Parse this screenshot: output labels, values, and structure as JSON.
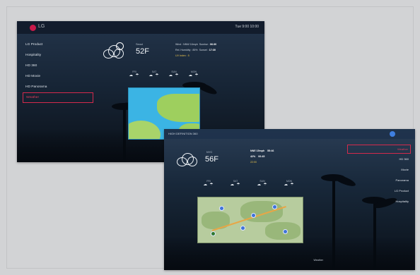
{
  "screen1": {
    "brand": "LG",
    "clock": "Tue 9:00 10:00",
    "menu": [
      "LG Product",
      "Hospitality",
      "HD 360",
      "HD Movie",
      "HD Panorama",
      "Weather"
    ],
    "weather": {
      "city": "Seoul",
      "temp": "52F",
      "wind": "Wind : NNW 16mph",
      "sunrise_label": "Sunrise :",
      "sunrise": "06:30",
      "humidity": "Rel. Humidity : 85%",
      "sunset_label": "Sunset :",
      "sunset": "17:30",
      "uv": "UV Index : 5"
    },
    "forecast": [
      {
        "day": "FRI",
        "icons": "☁ ☂"
      },
      {
        "day": "SAT",
        "icons": "☁ ☂"
      },
      {
        "day": "SUN",
        "icons": "☁ ☂"
      },
      {
        "day": "MON",
        "icons": "☁ ☂"
      }
    ]
  },
  "screen2": {
    "title": "HIGH DEFINITION 360",
    "weather": {
      "city": "NYC",
      "temp": "56F",
      "line1a": "NNE 15mph",
      "line1b": "55:46",
      "line2a": "42%",
      "line2b": "06:45",
      "line3": "22:00"
    },
    "forecast": [
      {
        "day": "FRI",
        "icons": "☁ ☂"
      },
      {
        "day": "SAT",
        "icons": "☁ ☂"
      },
      {
        "day": "SUN",
        "icons": "☁ ☂"
      },
      {
        "day": "MON",
        "icons": "☁ ☂"
      }
    ],
    "right_menu": [
      "Weather",
      "HD 360",
      "Movie",
      "Panorama",
      "LG Product",
      "Hospitality"
    ],
    "footer": "Weather"
  }
}
